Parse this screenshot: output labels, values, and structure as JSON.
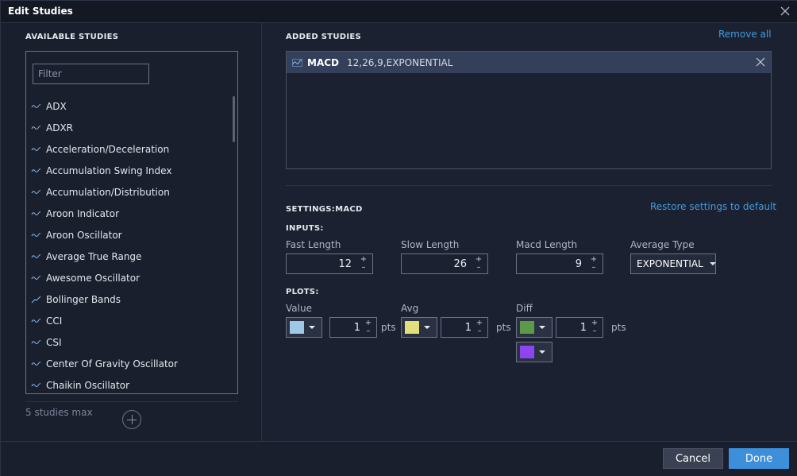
{
  "window": {
    "title": "Edit Studies"
  },
  "available": {
    "heading": "AVAILABLE STUDIES",
    "filter_placeholder": "Filter",
    "items": [
      {
        "label": "ADX",
        "icon": "study-wave-icon"
      },
      {
        "label": "ADXR",
        "icon": "study-wave-icon"
      },
      {
        "label": "Acceleration/Deceleration",
        "icon": "study-wave-icon"
      },
      {
        "label": "Accumulation Swing Index",
        "icon": "study-wave-icon"
      },
      {
        "label": "Accumulation/Distribution",
        "icon": "study-wave-icon"
      },
      {
        "label": "Aroon Indicator",
        "icon": "study-wave-icon"
      },
      {
        "label": "Aroon Oscillator",
        "icon": "study-wave-icon"
      },
      {
        "label": "Average True Range",
        "icon": "study-wave-icon"
      },
      {
        "label": "Awesome Oscillator",
        "icon": "study-wave-icon"
      },
      {
        "label": "Bollinger Bands",
        "icon": "study-trend-icon"
      },
      {
        "label": "CCI",
        "icon": "study-wave-icon"
      },
      {
        "label": "CSI",
        "icon": "study-wave-icon"
      },
      {
        "label": "Center Of Gravity Oscillator",
        "icon": "study-wave-icon"
      },
      {
        "label": "Chaikin Oscillator",
        "icon": "study-wave-icon"
      }
    ],
    "max_note": "5 studies max"
  },
  "added": {
    "heading": "ADDED STUDIES",
    "remove_all": "Remove all",
    "items": [
      {
        "name": "MACD",
        "params": "12,26,9,EXPONENTIAL"
      }
    ]
  },
  "settings": {
    "heading": "SETTINGS:MACD",
    "restore": "Restore settings to default",
    "inputs_heading": "INPUTS:",
    "fast_length": {
      "label": "Fast Length",
      "value": "12"
    },
    "slow_length": {
      "label": "Slow Length",
      "value": "26"
    },
    "macd_length": {
      "label": "Macd Length",
      "value": "9"
    },
    "average_type": {
      "label": "Average Type",
      "value": "EXPONENTIAL"
    },
    "plots_heading": "PLOTS:",
    "plots": {
      "value": {
        "label": "Value",
        "color": "#9dc9e6",
        "width": "1",
        "unit": "pts"
      },
      "avg": {
        "label": "Avg",
        "color": "#e1e07c",
        "width": "1",
        "unit": "pts"
      },
      "diff": {
        "label": "Diff",
        "color": "#5b9a4b",
        "color2": "#8e44f0",
        "width": "1",
        "unit": "pts"
      }
    }
  },
  "footer": {
    "cancel": "Cancel",
    "done": "Done"
  }
}
